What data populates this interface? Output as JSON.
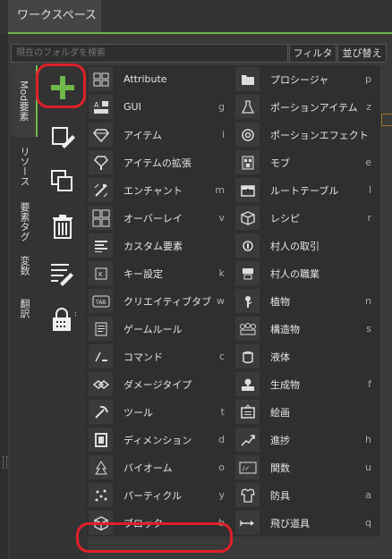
{
  "tab": {
    "label": "ワークスペース"
  },
  "search": {
    "placeholder": "現在のフォルダを検索"
  },
  "buttons": {
    "filter": "フィルタ",
    "sort": "並び替え"
  },
  "vtabs": [
    {
      "label": "Mod要素"
    },
    {
      "label": "リソース"
    },
    {
      "label": "要素タグ"
    },
    {
      "label": "変数"
    },
    {
      "label": "翻訳"
    }
  ],
  "tools": [
    {
      "icon": "plus-icon"
    },
    {
      "icon": "edit-icon"
    },
    {
      "icon": "duplicate-icon"
    },
    {
      "icon": "trash-icon"
    },
    {
      "icon": "list-edit-icon"
    },
    {
      "icon": "lock-icon"
    }
  ],
  "elements_left": [
    {
      "label": "Attribute",
      "key": "",
      "icon": "attribute-icon"
    },
    {
      "label": "GUI",
      "key": "g",
      "icon": "gui-icon"
    },
    {
      "label": "アイテム",
      "key": "i",
      "icon": "item-icon"
    },
    {
      "label": "アイテムの拡張",
      "key": "",
      "icon": "item-extension-icon"
    },
    {
      "label": "エンチャント",
      "key": "m",
      "icon": "enchantment-icon"
    },
    {
      "label": "オーバーレイ",
      "key": "v",
      "icon": "overlay-icon"
    },
    {
      "label": "カスタム要素",
      "key": "",
      "icon": "custom-element-icon"
    },
    {
      "label": "キー設定",
      "key": "k",
      "icon": "keybind-icon"
    },
    {
      "label": "クリエイティブタブ",
      "key": "w",
      "icon": "creative-tab-icon"
    },
    {
      "label": "ゲームルール",
      "key": "",
      "icon": "gamerule-icon"
    },
    {
      "label": "コマンド",
      "key": "c",
      "icon": "command-icon"
    },
    {
      "label": "ダメージタイプ",
      "key": "",
      "icon": "damage-type-icon"
    },
    {
      "label": "ツール",
      "key": "t",
      "icon": "tool-icon"
    },
    {
      "label": "ディメンション",
      "key": "d",
      "icon": "dimension-icon"
    },
    {
      "label": "バイオーム",
      "key": "o",
      "icon": "biome-icon"
    },
    {
      "label": "パーティクル",
      "key": "y",
      "icon": "particle-icon"
    },
    {
      "label": "ブロック",
      "key": "b",
      "icon": "block-icon"
    }
  ],
  "elements_right": [
    {
      "label": "プロシージャ",
      "key": "p",
      "icon": "procedure-icon"
    },
    {
      "label": "ポーションアイテム",
      "key": "z",
      "icon": "potion-item-icon"
    },
    {
      "label": "ポーションエフェクト",
      "key": "",
      "icon": "potion-effect-icon"
    },
    {
      "label": "モブ",
      "key": "e",
      "icon": "mob-icon"
    },
    {
      "label": "ルートテーブル",
      "key": "l",
      "icon": "loot-table-icon"
    },
    {
      "label": "レシピ",
      "key": "r",
      "icon": "recipe-icon"
    },
    {
      "label": "村人の取引",
      "key": "",
      "icon": "villager-trade-icon"
    },
    {
      "label": "村人の職業",
      "key": "",
      "icon": "villager-profession-icon"
    },
    {
      "label": "植物",
      "key": "n",
      "icon": "plant-icon"
    },
    {
      "label": "構造物",
      "key": "s",
      "icon": "structure-icon"
    },
    {
      "label": "液体",
      "key": "",
      "icon": "fluid-icon"
    },
    {
      "label": "生成物",
      "key": "f",
      "icon": "feature-icon"
    },
    {
      "label": "絵画",
      "key": "",
      "icon": "painting-icon"
    },
    {
      "label": "進捗",
      "key": "h",
      "icon": "advancement-icon"
    },
    {
      "label": "関数",
      "key": "u",
      "icon": "function-icon"
    },
    {
      "label": "防具",
      "key": "a",
      "icon": "armor-icon"
    },
    {
      "label": "飛び道具",
      "key": "q",
      "icon": "projectile-icon"
    }
  ],
  "colors": {
    "accent": "#6fb84a",
    "highlight": "#e0202a"
  }
}
